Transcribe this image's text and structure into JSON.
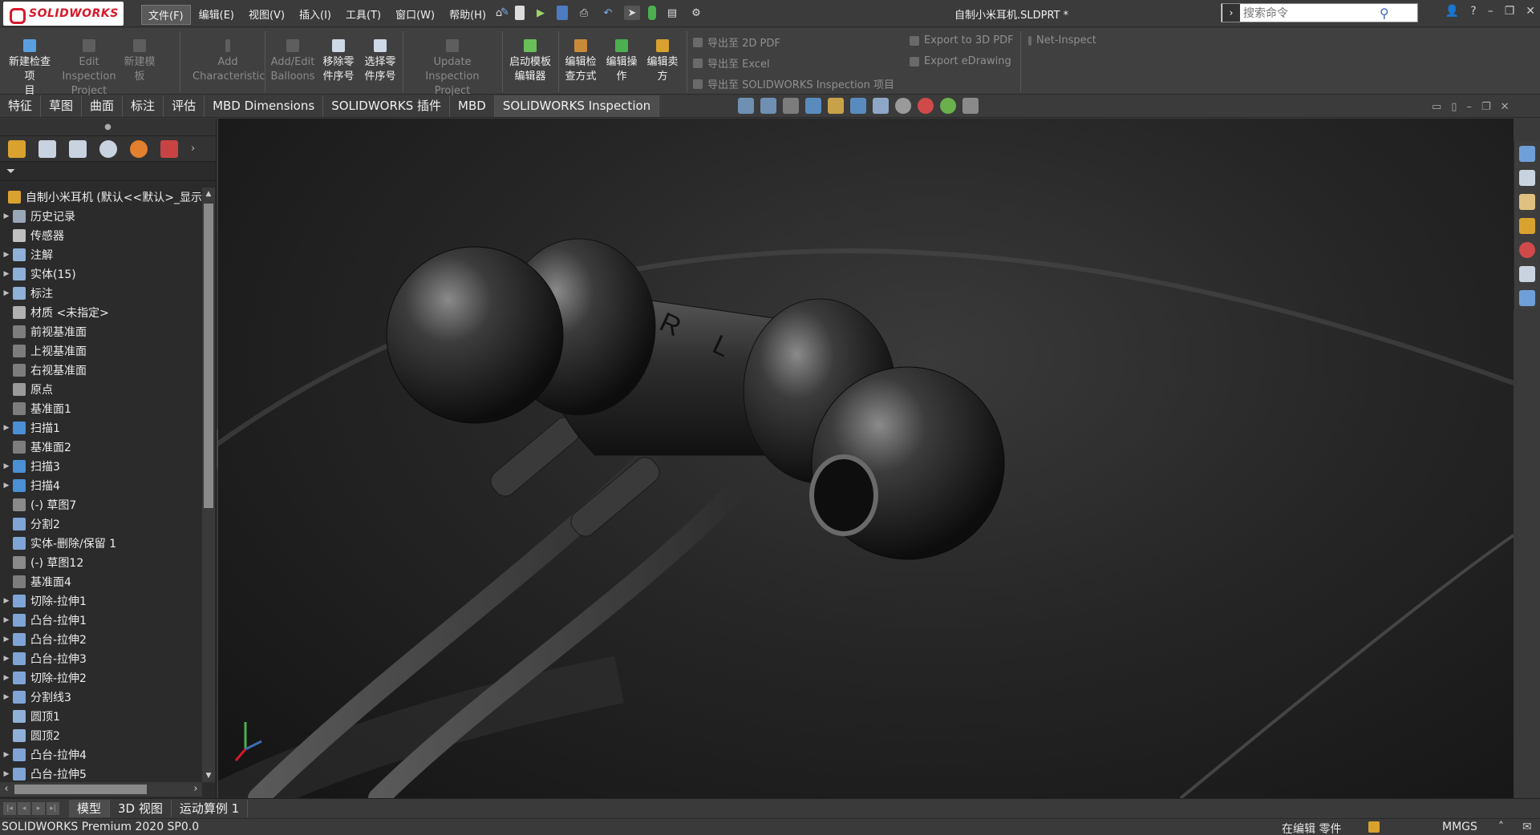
{
  "app": {
    "brand": "SOLIDWORKS",
    "document_title": "自制小米耳机.SLDPRT *"
  },
  "menu": [
    "文件(F)",
    "编辑(E)",
    "视图(V)",
    "插入(I)",
    "工具(T)",
    "窗口(W)",
    "帮助(H)"
  ],
  "search": {
    "placeholder": "搜索命令"
  },
  "command_manager": {
    "buttons": [
      {
        "line1": "新建检查项",
        "line2": "目(amp;N)",
        "enabled": true
      },
      {
        "line1": "Edit Inspection",
        "line2": "Project",
        "enabled": false
      },
      {
        "line1": "新建模",
        "line2": "板",
        "enabled": false
      },
      {
        "line1": "Add",
        "line2": "Characteristic",
        "enabled": false
      },
      {
        "line1": "Add/Edit",
        "line2": "Balloons",
        "enabled": false
      },
      {
        "line1": "移除零",
        "line2": "件序号",
        "enabled": true
      },
      {
        "line1": "选择零",
        "line2": "件序号",
        "enabled": true
      },
      {
        "line1": "Update Inspection",
        "line2": "Project",
        "enabled": false
      },
      {
        "line1": "启动模板",
        "line2": "编辑器",
        "enabled": true
      },
      {
        "line1": "编辑检",
        "line2": "查方式",
        "enabled": true
      },
      {
        "line1": "编辑操",
        "line2": "作",
        "enabled": true
      },
      {
        "line1": "编辑卖",
        "line2": "方",
        "enabled": true
      }
    ],
    "exports": {
      "pdf2d": "导出至 2D PDF",
      "excel": "导出至 Excel",
      "inspection_project": "导出至 SOLIDWORKS Inspection 项目",
      "pdf3d": "Export to 3D PDF",
      "edrawing": "Export eDrawing",
      "net_inspect": "Net-Inspect"
    }
  },
  "tabs": [
    "特征",
    "草图",
    "曲面",
    "标注",
    "评估",
    "MBD Dimensions",
    "SOLIDWORKS 插件",
    "MBD",
    "SOLIDWORKS Inspection"
  ],
  "active_tab": "SOLIDWORKS Inspection",
  "feature_tree": {
    "root": "自制小米耳机 (默认<<默认>_显示",
    "items": [
      {
        "label": "历史记录",
        "expandable": true,
        "icon": "history-icon"
      },
      {
        "label": "传感器",
        "expandable": false,
        "icon": "sensor-icon"
      },
      {
        "label": "注解",
        "expandable": true,
        "icon": "annotation-icon"
      },
      {
        "label": "实体(15)",
        "expandable": true,
        "icon": "solid-bodies-icon"
      },
      {
        "label": "标注",
        "expandable": true,
        "icon": "dimension-icon"
      },
      {
        "label": "材质 <未指定>",
        "expandable": false,
        "icon": "material-icon"
      },
      {
        "label": "前视基准面",
        "expandable": false,
        "icon": "plane-icon"
      },
      {
        "label": "上视基准面",
        "expandable": false,
        "icon": "plane-icon"
      },
      {
        "label": "右视基准面",
        "expandable": false,
        "icon": "plane-icon"
      },
      {
        "label": "原点",
        "expandable": false,
        "icon": "origin-icon"
      },
      {
        "label": "基准面1",
        "expandable": false,
        "icon": "plane-icon"
      },
      {
        "label": "扫描1",
        "expandable": true,
        "icon": "sweep-icon"
      },
      {
        "label": "基准面2",
        "expandable": false,
        "icon": "plane-icon"
      },
      {
        "label": "扫描3",
        "expandable": true,
        "icon": "sweep-icon"
      },
      {
        "label": "扫描4",
        "expandable": true,
        "icon": "sweep-icon"
      },
      {
        "label": "(-) 草图7",
        "expandable": false,
        "icon": "sketch-icon"
      },
      {
        "label": "分割2",
        "expandable": false,
        "icon": "split-icon"
      },
      {
        "label": "实体-删除/保留 1",
        "expandable": false,
        "icon": "delete-body-icon"
      },
      {
        "label": "(-) 草图12",
        "expandable": false,
        "icon": "sketch-icon"
      },
      {
        "label": "基准面4",
        "expandable": false,
        "icon": "plane-icon"
      },
      {
        "label": "切除-拉伸1",
        "expandable": true,
        "icon": "cut-extrude-icon"
      },
      {
        "label": "凸台-拉伸1",
        "expandable": true,
        "icon": "boss-extrude-icon"
      },
      {
        "label": "凸台-拉伸2",
        "expandable": true,
        "icon": "boss-extrude-icon"
      },
      {
        "label": "凸台-拉伸3",
        "expandable": true,
        "icon": "boss-extrude-icon"
      },
      {
        "label": "切除-拉伸2",
        "expandable": true,
        "icon": "cut-extrude-icon"
      },
      {
        "label": "分割线3",
        "expandable": true,
        "icon": "split-line-icon"
      },
      {
        "label": "圆顶1",
        "expandable": false,
        "icon": "dome-icon"
      },
      {
        "label": "圆顶2",
        "expandable": false,
        "icon": "dome-icon"
      },
      {
        "label": "凸台-拉伸4",
        "expandable": true,
        "icon": "boss-extrude-icon"
      },
      {
        "label": "凸台-拉伸5",
        "expandable": true,
        "icon": "boss-extrude-icon"
      }
    ]
  },
  "model_labels": {
    "left": "R",
    "right": "L"
  },
  "bottom_tabs": [
    "模型",
    "3D 视图",
    "运动算例 1"
  ],
  "status": {
    "product": "SOLIDWORKS Premium 2020 SP0.0",
    "mode": "在编辑 零件",
    "units": "MMGS"
  },
  "colors": {
    "brand_red": "#d5192a",
    "panel_bg": "#2b2b2b",
    "chrome_bg": "#3b3b3b"
  }
}
